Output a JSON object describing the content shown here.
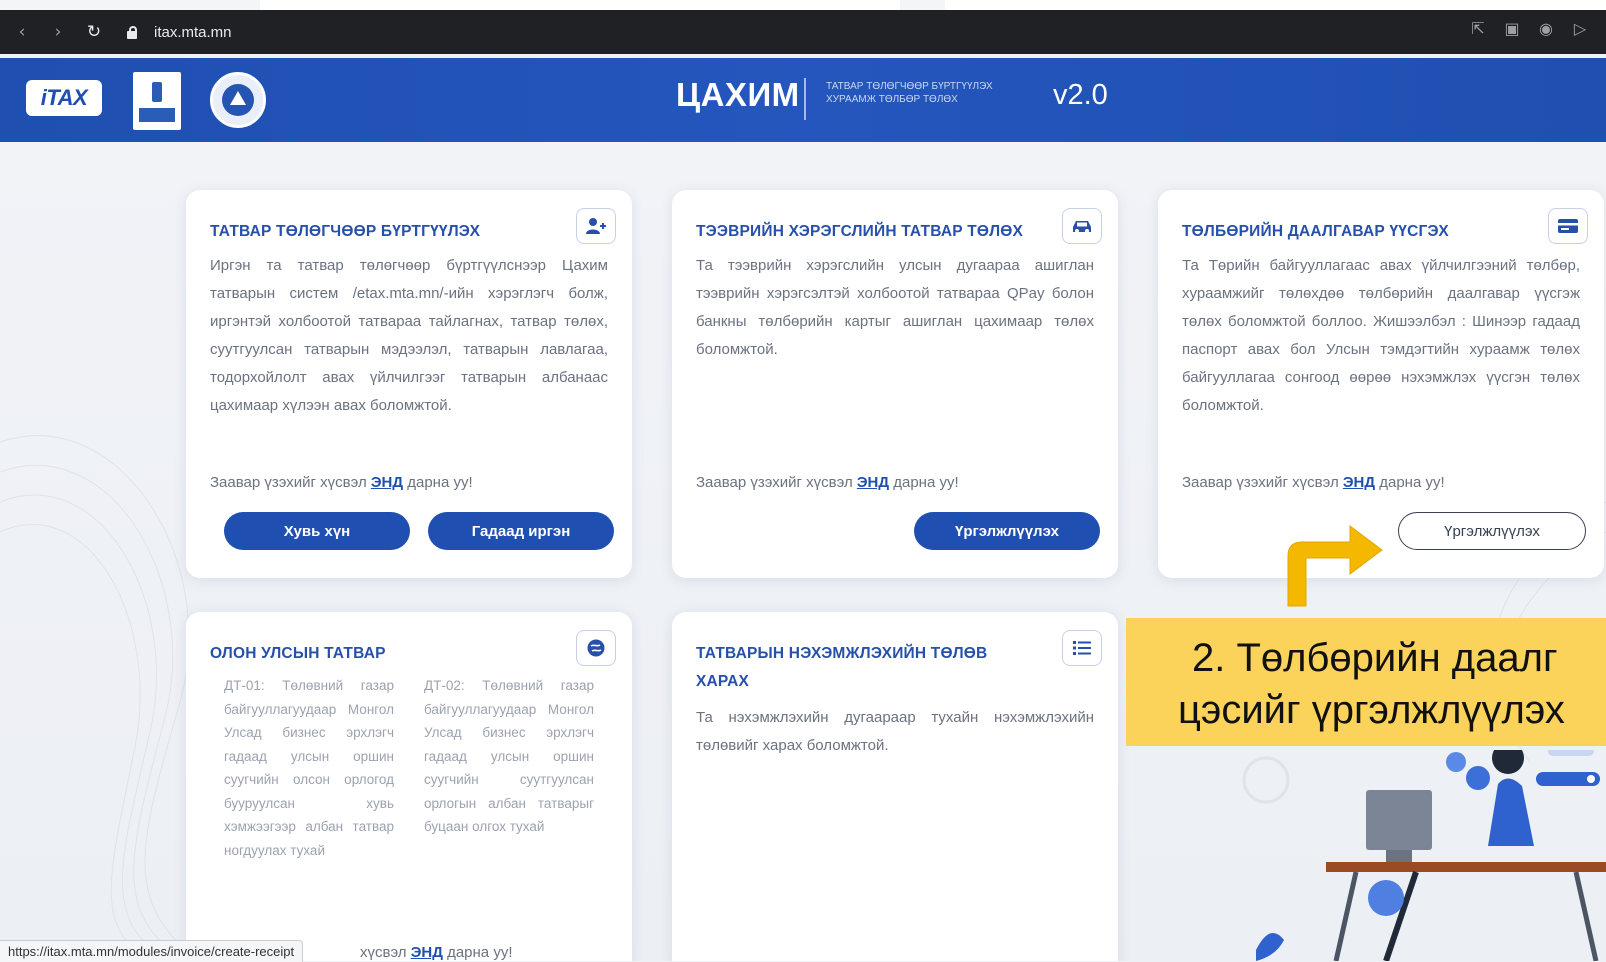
{
  "browser": {
    "url": "itax.mta.mn",
    "status_url": "https://itax.mta.mn/modules/invoice/create-receipt"
  },
  "header": {
    "logo_text": "iTAX",
    "title": "ЦАХИМ",
    "subtitle": "ТАТВАР ТӨЛӨГЧӨӨР БҮРТГҮҮЛЭХ ХУРААМЖ ТӨЛБӨР ТӨЛӨХ",
    "version": "v2.0"
  },
  "cards": [
    {
      "title": "ТАТВАР ТӨЛӨГЧӨӨР БҮРТГҮҮЛЭХ",
      "icon": "user-plus-icon",
      "body": "Иргэн та татвар төлөгчөөр бүртгүүлснээр Цахим татварын систем /etax.mta.mn/-ийн хэрэглэгч болж, иргэнтэй холбоотой татвараа тайлагнах, татвар төлөх, суутгуулсан татварын мэдээлэл, татварын лавлагаа, тодорхойлолт авах үйлчилгээг татварын албанаас цахимаар хүлээн авах боломжтой.",
      "guide_prefix": "Заавар үзэхийг хүсвэл ",
      "guide_link": "ЭНД",
      "guide_suffix": " дарна уу!",
      "buttons": [
        "Хувь хүн",
        "Гадаад иргэн"
      ]
    },
    {
      "title": "ТЭЭВРИЙН ХЭРЭГСЛИЙН ТАТВАР ТӨЛӨХ",
      "icon": "car-icon",
      "body": "Та тээврийн хэрэгслийн улсын дугаараа ашиглан тээврийн хэрэгсэлтэй холбоотой татвараа QPay болон банкны төлбөрийн картыг ашиглан цахимаар төлөх боломжтой.",
      "guide_prefix": "Заавар үзэхийг хүсвэл ",
      "guide_link": "ЭНД",
      "guide_suffix": " дарна уу!",
      "buttons": [
        "Үргэлжлүүлэх"
      ]
    },
    {
      "title": "ТӨЛБӨРИЙН ДААЛГАВАР ҮҮСГЭХ",
      "icon": "card-icon",
      "body": "Та Төрийн байгууллагаас авах үйлчилгээний төлбөр, хураамжийг төлөхдөө төлбөрийн даалгавар үүсгэж төлөх боломжтой боллоо. Жишээлбэл : Шинээр гадаад паспорт авах бол Улсын тэмдэгтийн хураамж төлөх байгууллагаа сонгоод өөрөө нэхэмжлэх үүсгэн төлөх боломжтой.",
      "guide_prefix": "Заавар үзэхийг хүсвэл ",
      "guide_link": "ЭНД",
      "guide_suffix": " дарна уу!",
      "buttons": [
        "Үргэлжлүүлэх"
      ]
    },
    {
      "title": "ОЛОН УЛСЫН ТАТВАР",
      "icon": "globe-icon",
      "col1": "ДТ-01: Төлөвний газар байгууллагуудаар Монгол Улсад бизнес эрхлэгч гадаад улсын оршин суугчийн олсон орлогод бууруулсан хувь хэмжээгээр албан татвар ногдуулах тухай",
      "col2": "ДТ-02: Төлөвний газар байгууллагуудаар Монгол Улсад бизнес эрхлэгч гадаад улсын оршин суугчийн суутгуулсан орлогын албан татварыг буцаан олгох тухай"
    },
    {
      "title": "ТАТВАРЫН НЭХЭМЖЛЭХИЙН ТӨЛӨВ ХАРАХ",
      "icon": "list-icon",
      "body": "Та нэхэмжлэхийн дугаараар тухайн нэхэмжлэхийн төлөвийг харах боломжтой."
    }
  ],
  "peek_guide": {
    "prefix": "хүсвэл ",
    "link": "ЭНД",
    "suffix": " дарна уу!"
  },
  "tutorial": {
    "line1": "2. Төлбөрийн даалг",
    "line2": "цэсийг үргэлжлүүлэх"
  },
  "colors": {
    "brand_blue": "#1f4fb0",
    "title_blue": "#2650a9",
    "highlight_yellow": "#fbd25a",
    "arrow_orange": "#f5b800"
  }
}
